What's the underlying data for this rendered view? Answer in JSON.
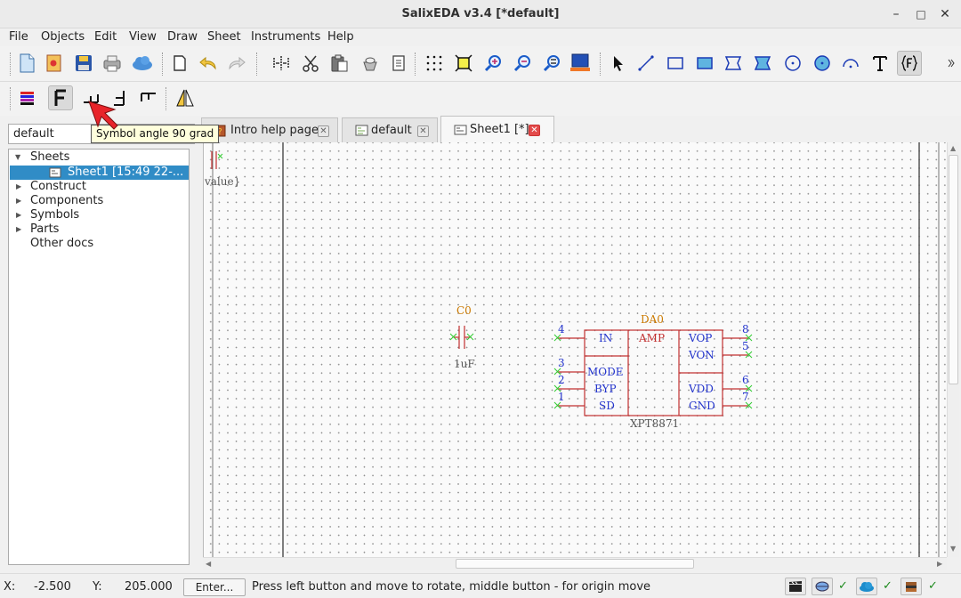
{
  "window": {
    "title": "SalixEDA v3.4 [*default]"
  },
  "menu": [
    "File",
    "Objects",
    "Edit",
    "View",
    "Draw",
    "Sheet",
    "Instruments",
    "Help"
  ],
  "tooltip": "Symbol angle 90 grad",
  "project": {
    "value": "default"
  },
  "tree": {
    "sheets_label": "Sheets",
    "sheet_item": "Sheet1 [15:49 22-...",
    "construct_label": "Construct",
    "components_label": "Components",
    "symbols_label": "Symbols",
    "parts_label": "Parts",
    "other_label": "Other docs"
  },
  "tabs": [
    {
      "label": "Intro help page"
    },
    {
      "label": "default"
    },
    {
      "label": "Sheet1 [*]"
    }
  ],
  "schematic": {
    "capacitor": {
      "name": "C0",
      "value": "1uF"
    },
    "partial_value": "value}",
    "amp": {
      "name": "DA0",
      "center_label": "AMP",
      "part": "XPT8871",
      "left_pins": [
        {
          "num": "4",
          "label": "IN"
        },
        {
          "num": "3",
          "label": "MODE"
        },
        {
          "num": "2",
          "label": "BYP"
        },
        {
          "num": "1",
          "label": "SD"
        }
      ],
      "right_pins": [
        {
          "num": "8",
          "label": "VOP"
        },
        {
          "num": "5",
          "label": "VON"
        },
        {
          "num": "6",
          "label": "VDD"
        },
        {
          "num": "7",
          "label": "GND"
        }
      ]
    }
  },
  "status": {
    "x_label": "X:",
    "x_value": "-2.500",
    "y_label": "Y:",
    "y_value": "205.000",
    "enter_label": "Enter...",
    "message": "Press left button and move to rotate, middle button - for origin move",
    "checks": [
      "✓",
      "✓",
      "✓"
    ]
  },
  "colors": {
    "selection": "#308cc6",
    "symbol": "#c23030",
    "pin_number": "#2233cc",
    "ref": "#cc7a00",
    "connector": "#33cc33"
  }
}
